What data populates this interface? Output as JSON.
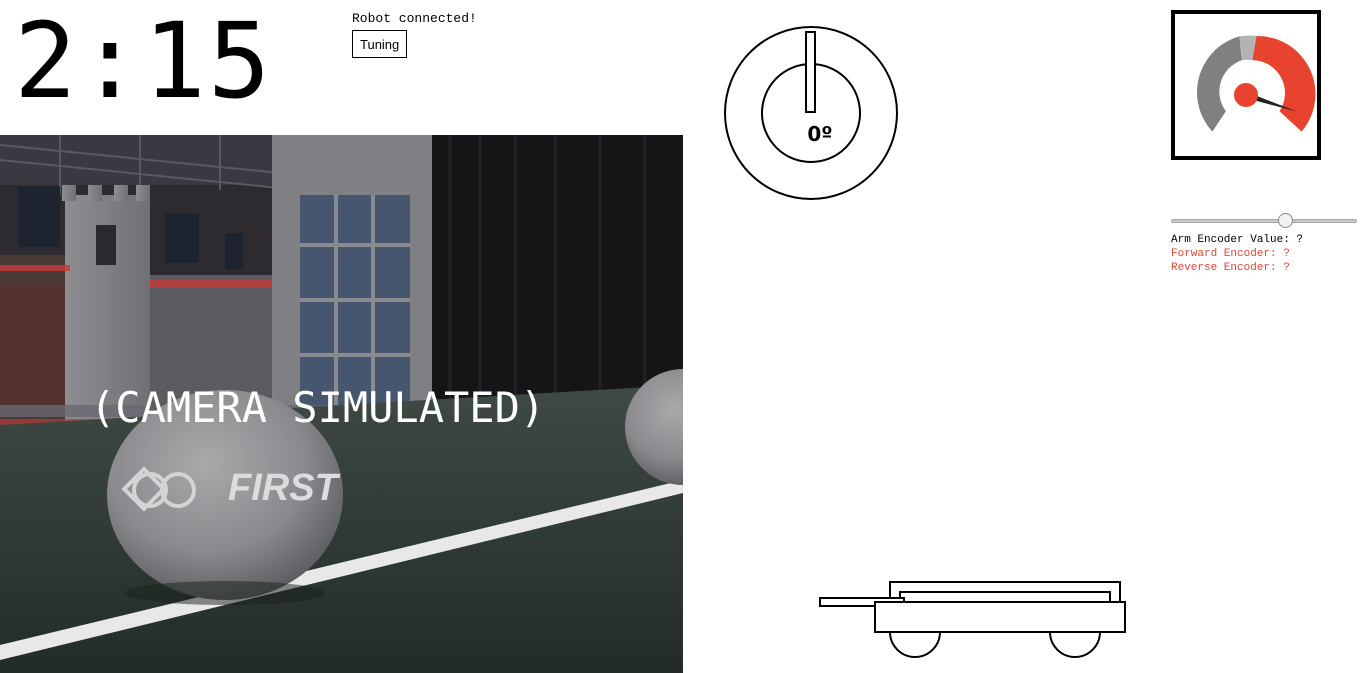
{
  "timer": {
    "text": "2:15"
  },
  "robot_state": {
    "text": "Robot connected!"
  },
  "tuning_button": {
    "label": "Tuning"
  },
  "camera": {
    "overlay_text": "(CAMERA SIMULATED)"
  },
  "gyro": {
    "readout": "0º",
    "angle_degrees": 0
  },
  "gauge": {
    "needle_fraction": 0.9,
    "colors": {
      "dark": "#808080",
      "light": "#b3b3b3",
      "red": "#e8432f"
    }
  },
  "arm": {
    "slider_fraction": 0.63,
    "encoder_value_text": "Arm Encoder Value: ?",
    "forward_encoder_text": "Forward Encoder: ?",
    "reverse_encoder_text": "Reverse Encoder: ?"
  },
  "colors": {
    "accent_red": "#e8432f",
    "text": "#000000"
  }
}
